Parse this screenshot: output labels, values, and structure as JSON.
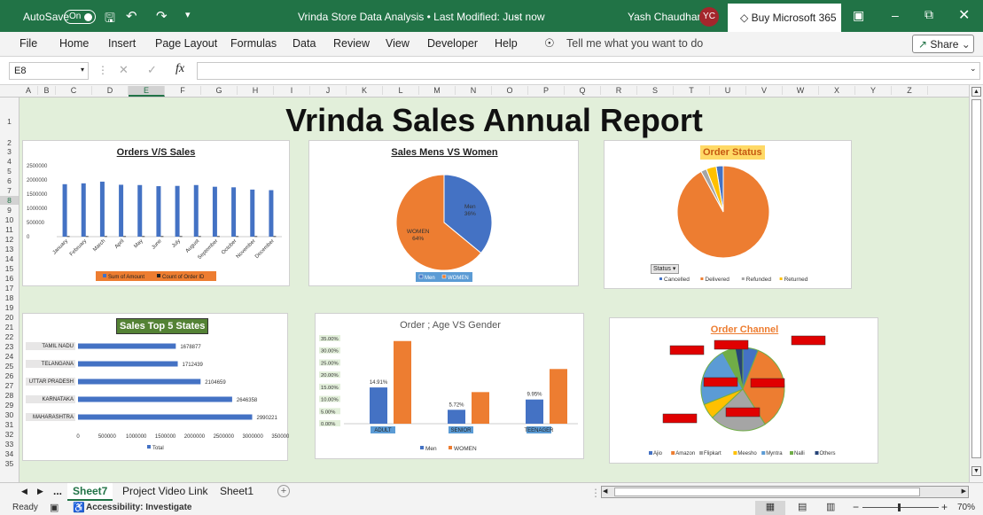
{
  "titlebar": {
    "autosave": "AutoSave",
    "toggle": "On",
    "doc_title": "Vrinda Store Data Analysis • Last Modified: Just now",
    "user": "Yash Chaudhary",
    "initials": "YC",
    "buy": "Buy Microsoft 365"
  },
  "ribbon": {
    "tabs": [
      "File",
      "Home",
      "Insert",
      "Page Layout",
      "Formulas",
      "Data",
      "Review",
      "View",
      "Developer",
      "Help"
    ],
    "tell_me": "Tell me what you want to do",
    "share": "Share"
  },
  "formula_bar": {
    "name_box": "E8",
    "formula": ""
  },
  "columns": [
    "A",
    "B",
    "C",
    "D",
    "E",
    "F",
    "G",
    "H",
    "I",
    "J",
    "K",
    "L",
    "M",
    "N",
    "O",
    "P",
    "Q",
    "R",
    "S",
    "T",
    "U",
    "V",
    "W",
    "X",
    "Y",
    "Z"
  ],
  "rows": [
    "1",
    "2",
    "3",
    "4",
    "5",
    "6",
    "7",
    "8",
    "9",
    "10",
    "11",
    "12",
    "13",
    "14",
    "15",
    "16",
    "17",
    "18",
    "19",
    "20",
    "21",
    "22",
    "23",
    "24",
    "25",
    "26",
    "27",
    "28",
    "29",
    "30",
    "31",
    "32",
    "33",
    "34",
    "35"
  ],
  "report_title": "Vrinda Sales Annual Report",
  "chart_data": [
    {
      "type": "bar",
      "title": "Orders V/S Sales",
      "categories": [
        "January",
        "February",
        "March",
        "April",
        "May",
        "June",
        "July",
        "August",
        "September",
        "October",
        "November",
        "December"
      ],
      "series": [
        {
          "name": "Sum of Amount",
          "values": [
            1850000,
            1880000,
            1940000,
            1830000,
            1820000,
            1780000,
            1790000,
            1820000,
            1760000,
            1740000,
            1660000,
            1640000
          ],
          "color": "#4472c4"
        },
        {
          "name": "Count of Order ID",
          "values": [
            2800,
            2850,
            2900,
            2750,
            2750,
            2700,
            2700,
            2750,
            2650,
            2650,
            2500,
            2480
          ],
          "color": "#222222"
        }
      ],
      "yticks": [
        "0",
        "500000",
        "1000000",
        "1500000",
        "2000000",
        "2500000"
      ],
      "ylim": [
        0,
        2500000
      ]
    },
    {
      "type": "pie",
      "title": "Sales Mens VS Women",
      "slices": [
        {
          "name": "Men",
          "label": "Men\n36%",
          "value": 36,
          "color": "#4472c4"
        },
        {
          "name": "WOMEN",
          "label": "WOMEN\n64%",
          "value": 64,
          "color": "#ed7d31"
        }
      ]
    },
    {
      "type": "pie",
      "title": "Order Status",
      "filter_label": "Status",
      "slices": [
        {
          "name": "Cancelled",
          "value": 2.5,
          "color": "#4472c4"
        },
        {
          "name": "Delivered",
          "value": 92,
          "color": "#ed7d31"
        },
        {
          "name": "Refunded",
          "value": 2,
          "color": "#a5a5a5"
        },
        {
          "name": "Returned",
          "value": 3.5,
          "color": "#ffc000"
        }
      ]
    },
    {
      "type": "bar",
      "title": "Sales Top 5  States",
      "categories": [
        "TAMIL NADU",
        "TELANGANA",
        "UTTAR PRADESH",
        "KARNATAKA",
        "MAHARASHTRA"
      ],
      "values": [
        1678877,
        1712439,
        2104659,
        2646358,
        2990221
      ],
      "value_labels": [
        "1678877",
        "1712439",
        "2104659",
        "2646358",
        "2990221"
      ],
      "xticks": [
        "0",
        "500000",
        "1000000",
        "1500000",
        "2000000",
        "2500000",
        "3000000",
        "3500000"
      ],
      "xlim": [
        0,
        3500000
      ],
      "legend": "Total"
    },
    {
      "type": "bar",
      "title": "Order ; Age VS Gender",
      "categories": [
        "ADULT",
        "SENIOR",
        "TEENAGER"
      ],
      "series": [
        {
          "name": "Men",
          "values": [
            14.91,
            5.72,
            9.95
          ],
          "labels": [
            "14.91%",
            "5.72%",
            "9.95%"
          ],
          "color": "#4472c4"
        },
        {
          "name": "WOMEN",
          "values": [
            34.0,
            13.0,
            22.5
          ],
          "color": "#ed7d31"
        }
      ],
      "yticks": [
        "0.00%",
        "5.00%",
        "10.00%",
        "15.00%",
        "20.00%",
        "25.00%",
        "30.00%",
        "35.00%"
      ],
      "ylim": [
        0,
        35
      ]
    },
    {
      "type": "pie",
      "title": "Order Channel",
      "slices": [
        {
          "name": "Ajio",
          "value": 6,
          "color": "#4472c4"
        },
        {
          "name": "Amazon",
          "value": 35,
          "color": "#ed7d31"
        },
        {
          "name": "Flipkart",
          "value": 22,
          "color": "#a5a5a5"
        },
        {
          "name": "Meesho",
          "value": 6,
          "color": "#ffc000"
        },
        {
          "name": "Myntra",
          "value": 23,
          "color": "#5b9bd5"
        },
        {
          "name": "Nalli",
          "value": 5,
          "color": "#70ad47"
        },
        {
          "name": "Others",
          "value": 3,
          "color": "#264478"
        }
      ]
    }
  ],
  "sheet_tabs": {
    "ellipsis": "...",
    "active": "Sheet7",
    "others": [
      "Project Video Link",
      "Sheet1"
    ]
  },
  "status": {
    "ready": "Ready",
    "accessibility": "Accessibility: Investigate",
    "zoom": "70%"
  }
}
